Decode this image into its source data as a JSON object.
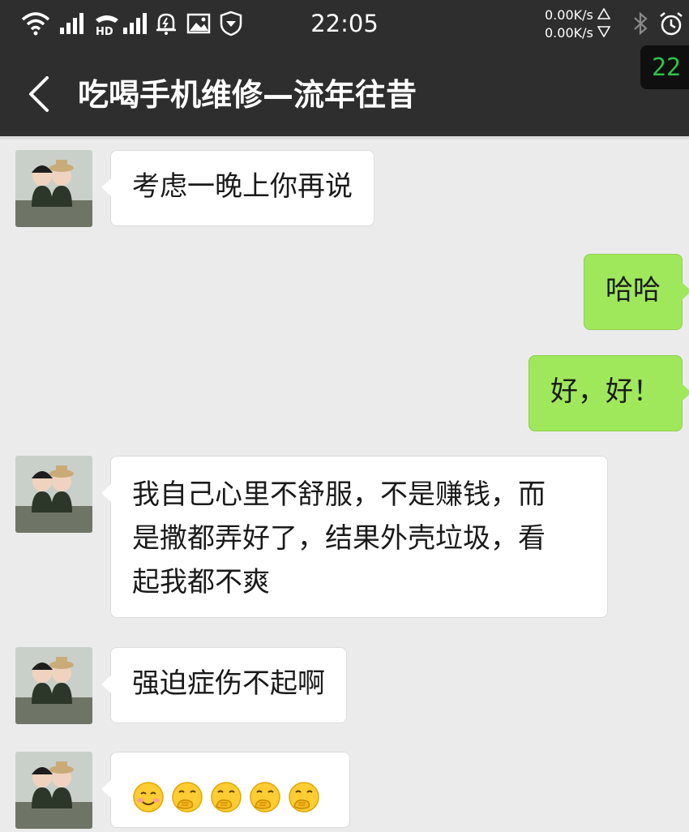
{
  "status_bar": {
    "time": "22:05",
    "net_up": "0.00K/s",
    "net_down": "0.00K/s",
    "icons": [
      "wifi-icon",
      "signal-1-icon",
      "hd-call-icon",
      "signal-2-icon",
      "alarm-bell-icon",
      "image-icon",
      "shield-icon",
      "bluetooth-icon",
      "alarm-clock-icon"
    ]
  },
  "header": {
    "back_icon": "chevron-left-icon",
    "title": "吃喝手机维修—流年往昔",
    "unread_badge": "22"
  },
  "messages": [
    {
      "side": "left",
      "text": "考虑一晚上你再说"
    },
    {
      "side": "right",
      "text": "哈哈"
    },
    {
      "side": "right",
      "text": "好，好！"
    },
    {
      "side": "left",
      "lines": [
        "我自己心里不舒服，不是赚钱，而",
        "是撒都弄好了，结果外壳垃圾，看",
        "起我都不爽"
      ]
    },
    {
      "side": "left",
      "text": "强迫症伤不起啊"
    },
    {
      "side": "left",
      "emojis": [
        "smiling-face-icon",
        "hand-over-mouth-icon",
        "hand-over-mouth-icon",
        "hand-over-mouth-icon",
        "hand-over-mouth-icon"
      ]
    }
  ],
  "colors": {
    "bar": "#2e2e2e",
    "chat_bg": "#ebebeb",
    "outgoing_bubble": "#9fe85b",
    "incoming_bubble": "#ffffff",
    "badge_text": "#2fc24a"
  }
}
